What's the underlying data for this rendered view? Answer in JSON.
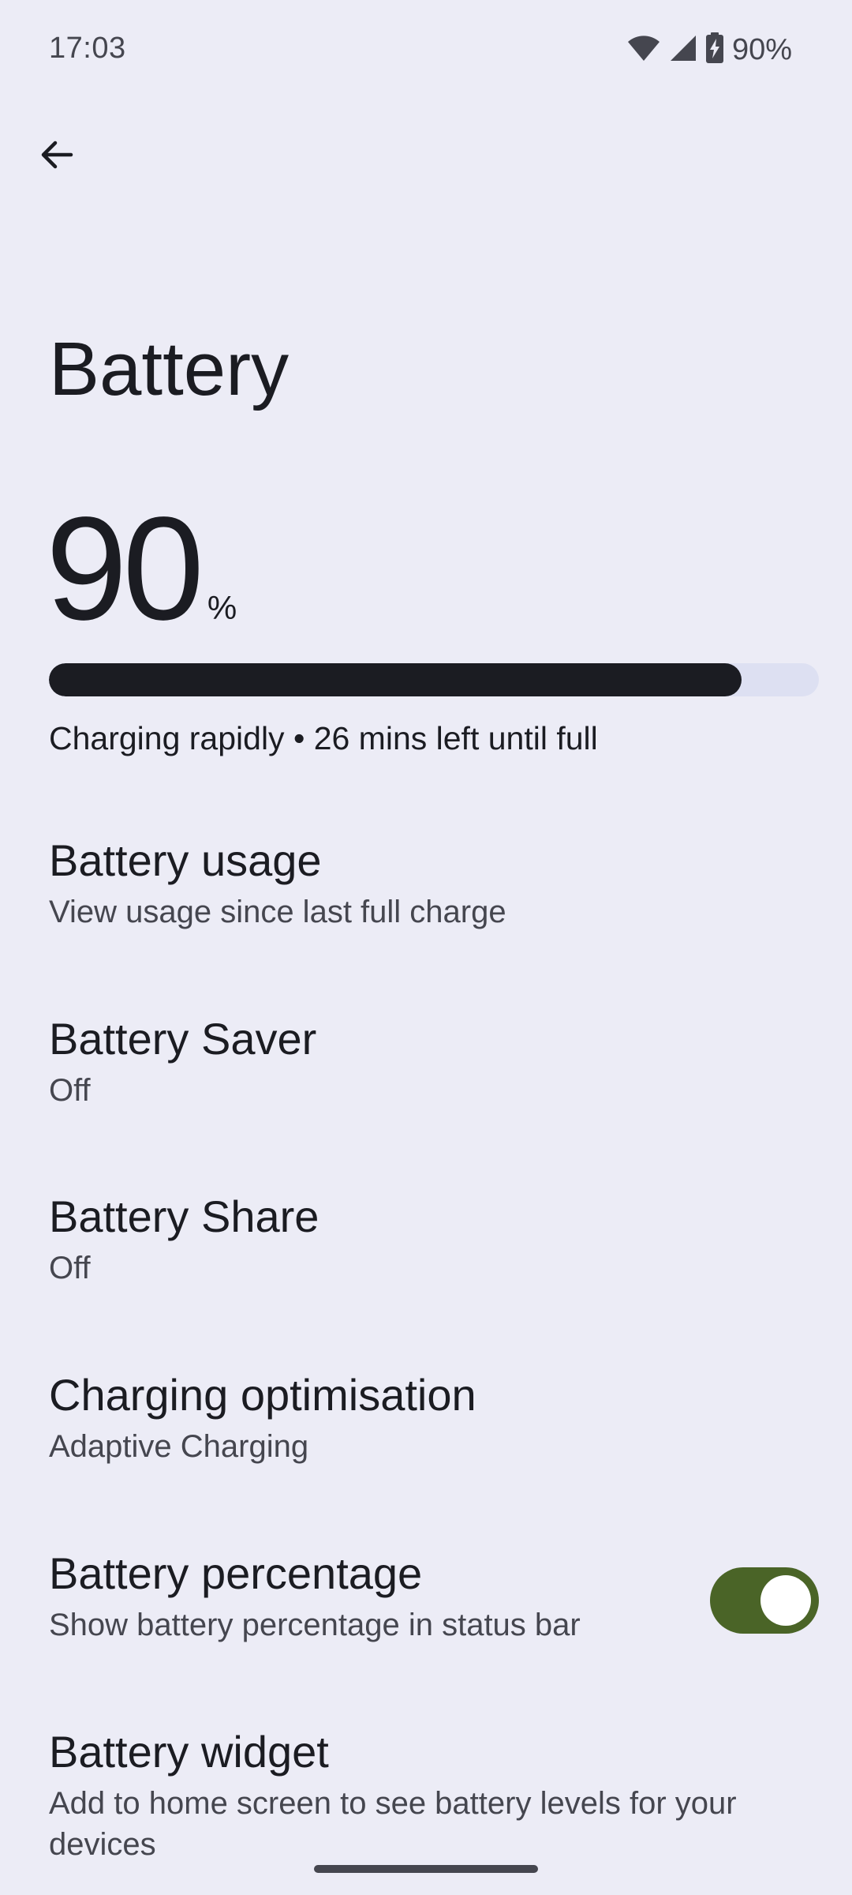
{
  "status_bar": {
    "time": "17:03",
    "battery_percent_label": "90%",
    "icons": [
      "wifi-icon",
      "signal-icon",
      "battery-charging-icon"
    ]
  },
  "header": {
    "back_icon": "arrow-back-icon",
    "title": "Battery"
  },
  "battery_level": {
    "value": "90",
    "unit": "%",
    "fill_fraction": 0.9,
    "status": "Charging rapidly • 26 mins left until full"
  },
  "settings": [
    {
      "title": "Battery usage",
      "summary": "View usage since last full charge"
    },
    {
      "title": "Battery Saver",
      "summary": "Off"
    },
    {
      "title": "Battery Share",
      "summary": "Off"
    },
    {
      "title": "Charging optimisation",
      "summary": "Adaptive Charging"
    },
    {
      "title": "Battery percentage",
      "summary": "Show battery percentage in status bar",
      "toggle_on": true
    },
    {
      "title": "Battery widget",
      "summary": "Add to home screen to see battery levels for your devices"
    }
  ],
  "colors": {
    "background": "#ECECF6",
    "bar_fill": "#1B1C22",
    "bar_track": "#DDE0F2",
    "toggle_on": "#4A6427"
  }
}
